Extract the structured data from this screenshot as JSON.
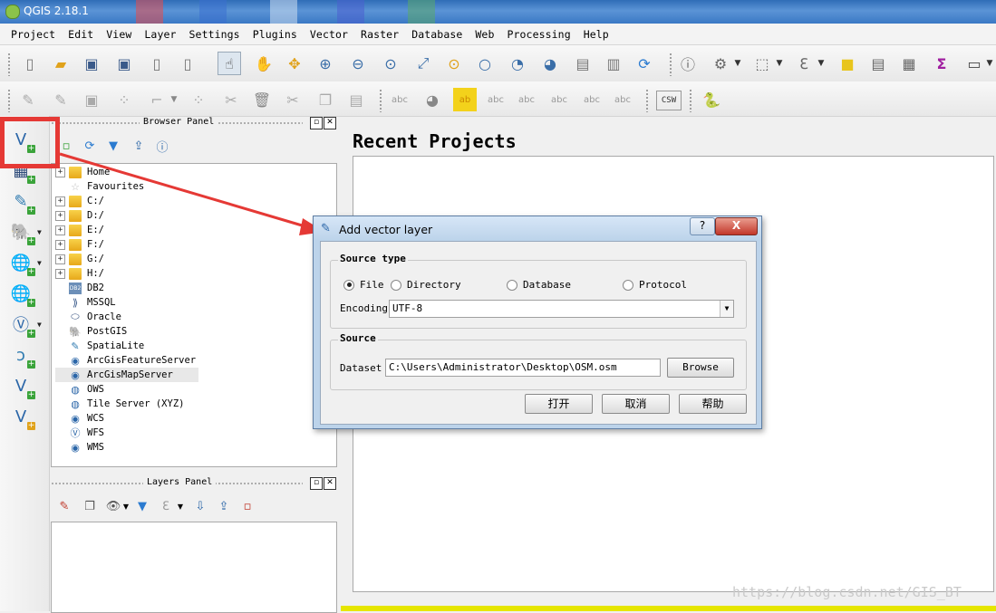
{
  "window": {
    "title": "QGIS 2.18.1"
  },
  "menubar": [
    "Project",
    "Edit",
    "View",
    "Layer",
    "Settings",
    "Plugins",
    "Vector",
    "Raster",
    "Database",
    "Web",
    "Processing",
    "Help"
  ],
  "toolbar1_icons": [
    "new-project",
    "open-project",
    "save-project",
    "save-as",
    "new-print-composer",
    "composer-manager",
    "touch-zoom",
    "pan",
    "pan-to-selection",
    "zoom-in",
    "zoom-out",
    "zoom-native",
    "zoom-full",
    "zoom-layer",
    "zoom-selection",
    "zoom-last",
    "zoom-next",
    "new-bookmark",
    "show-bookmarks",
    "refresh",
    "identify",
    "run-action",
    "select-features",
    "measure-expression",
    "deselect-all",
    "open-attribute-table",
    "field-calculator",
    "statistical-summary",
    "measure-line"
  ],
  "toolbar2_icons": [
    "edits",
    "toggle-editing",
    "save-layer-edits",
    "add-feature",
    "move-feature",
    "node-tool",
    "delete-selected",
    "cut-features",
    "copy-features",
    "paste-features",
    "label-tool",
    "pin-labels",
    "show-hide-labels",
    "highlight-pinned",
    "move-label",
    "rotate-label",
    "change-label",
    "csw-label",
    "python-console"
  ],
  "toolbar2_text": {
    "csw": "CSW"
  },
  "left_toolbar_icons": [
    "add-vector-layer",
    "add-raster-layer",
    "add-spatialite-layer",
    "add-postgis-layer",
    "add-wms-layer",
    "add-wcs-layer",
    "add-wfs-layer",
    "add-delimited-text-layer",
    "add-virtual-layer",
    "new-shapefile-layer"
  ],
  "browser_panel": {
    "title": "Browser Panel",
    "items": [
      "Home",
      "Favourites",
      "C:/",
      "D:/",
      "E:/",
      "F:/",
      "G:/",
      "H:/",
      "DB2",
      "MSSQL",
      "Oracle",
      "PostGIS",
      "SpatiaLite",
      "ArcGisFeatureServer",
      "ArcGisMapServer",
      "OWS",
      "Tile Server (XYZ)",
      "WCS",
      "WFS",
      "WMS"
    ],
    "db2_icon_text": "DB2"
  },
  "layers_panel": {
    "title": "Layers Panel"
  },
  "main": {
    "recent_title": "Recent Projects"
  },
  "watermark": "https://blog.csdn.net/GIS_BT",
  "dialog": {
    "title": "Add vector layer",
    "help": "?",
    "close": "X",
    "source_type_title": "Source type",
    "options": [
      "File",
      "Directory",
      "Database",
      "Protocol"
    ],
    "selected_option": "File",
    "encoding_label": "Encoding",
    "encoding_value": "UTF-8",
    "source_title": "Source",
    "dataset_label": "Dataset",
    "dataset_value": "C:\\Users\\Administrator\\Desktop\\OSM.osm",
    "browse_button": "Browse",
    "open_button": "打开",
    "cancel_button": "取消",
    "help_button": "帮助"
  },
  "colors": {
    "annotation_red": "#e53935",
    "titlebar_blue": "#3a78c4",
    "yellow_bar": "#e6e600"
  }
}
